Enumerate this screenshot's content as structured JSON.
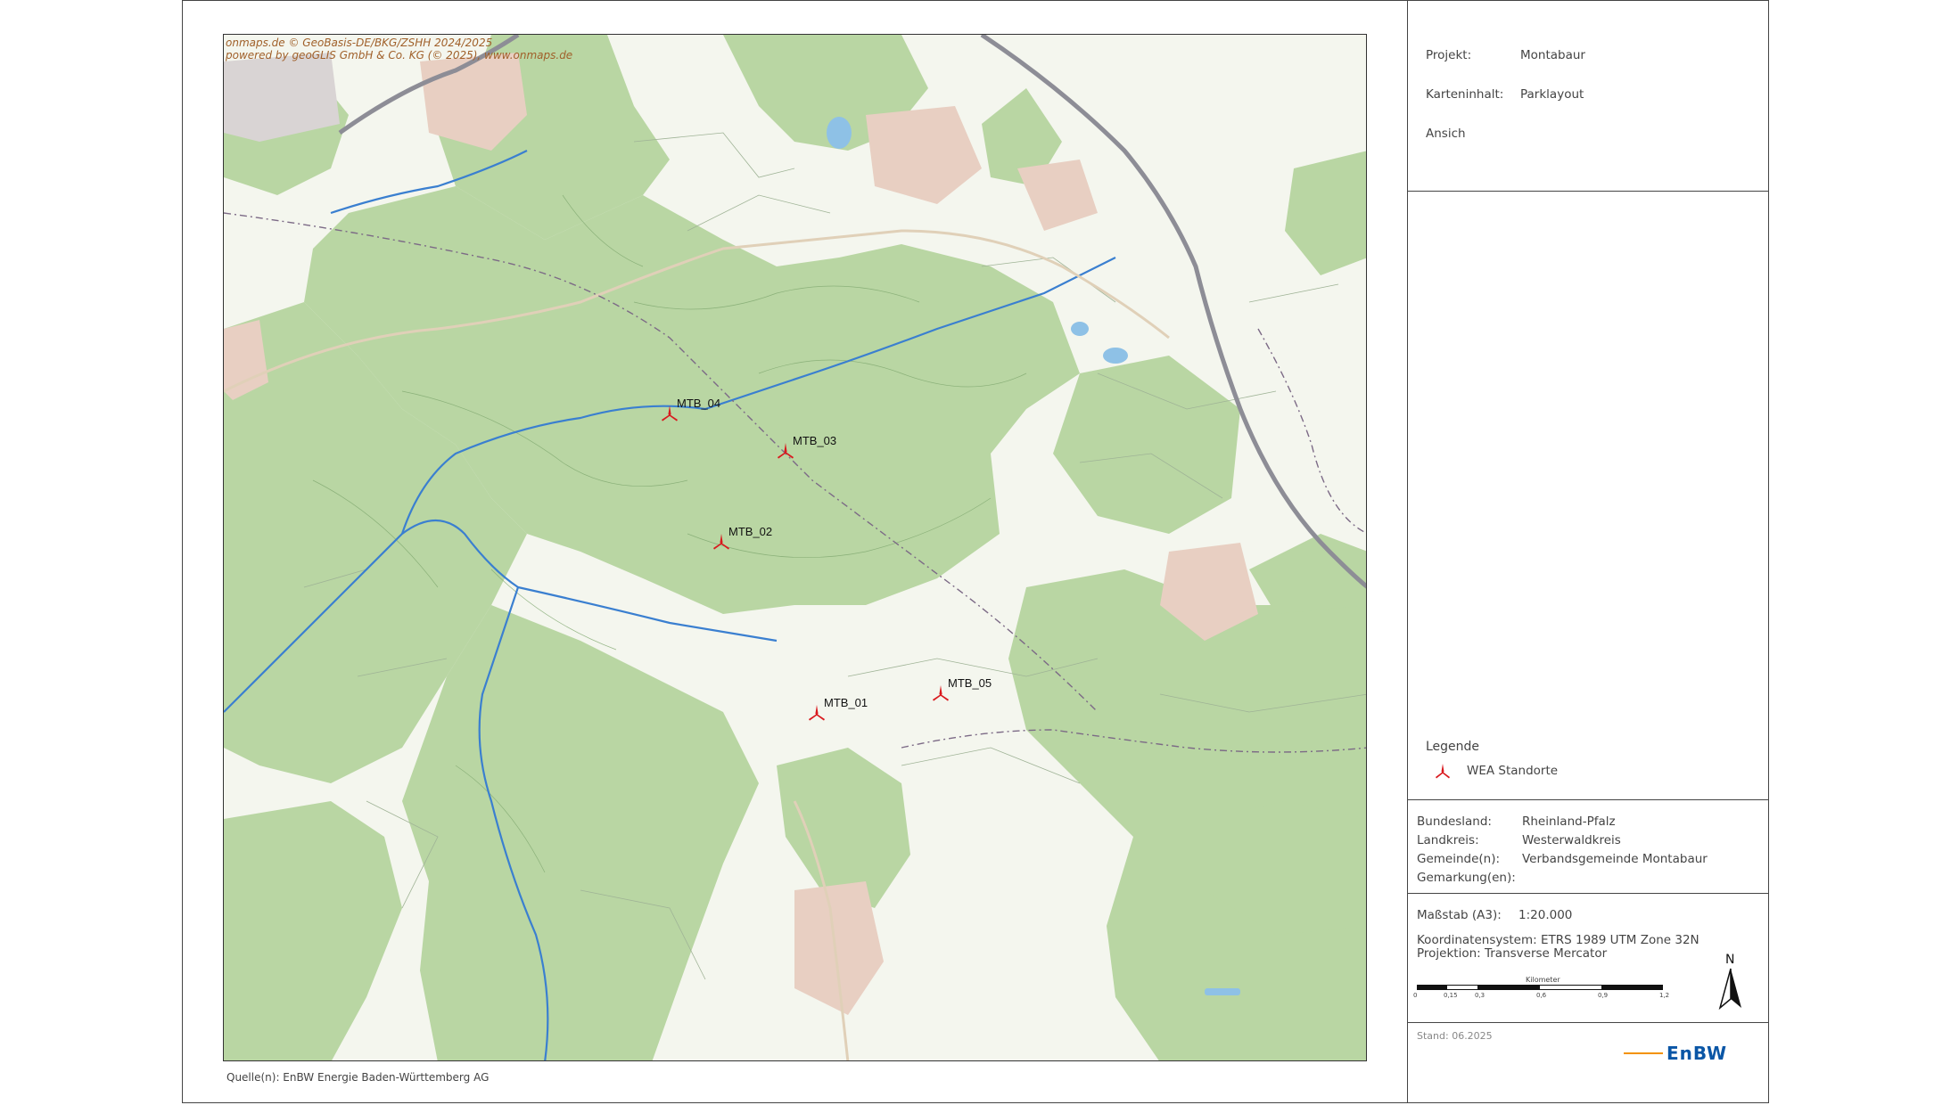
{
  "map": {
    "copyright_line1": "onmaps.de © GeoBasis-DE/BKG/ZSHH 2024/2025",
    "copyright_line2": "powered by geoGLIS GmbH & Co. KG (© 2025), www.onmaps.de",
    "source": "Quelle(n):   EnBW Energie Baden-Württemberg AG",
    "turbines": [
      {
        "id": "MTB_01",
        "label": "MTB_01"
      },
      {
        "id": "MTB_02",
        "label": "MTB_02"
      },
      {
        "id": "MTB_03",
        "label": "MTB_03"
      },
      {
        "id": "MTB_04",
        "label": "MTB_04"
      },
      {
        "id": "MTB_05",
        "label": "MTB_05"
      }
    ],
    "colors": {
      "forest": "#b9d6a3",
      "open": "#f4f6ee",
      "water": "#3a7fd0",
      "road": "#8d8d96",
      "turbine": "#d9191e"
    }
  },
  "info": {
    "projekt_label": "Projekt:",
    "projekt_value": "Montabaur",
    "karteninhalt_label": "Karteninhalt:",
    "karteninhalt_value": "Parklayout",
    "ansicht_label": "Ansich"
  },
  "legend": {
    "title": "Legende",
    "item": "WEA Standorte",
    "icon": "wind-turbine-icon"
  },
  "admin": {
    "bundesland_label": "Bundesland:",
    "bundesland_value": "Rheinland-Pfalz",
    "landkreis_label": "Landkreis:",
    "landkreis_value": "Westerwaldkreis",
    "gemeinde_label": "Gemeinde(n):",
    "gemeinde_value": "Verbandsgemeinde Montabaur",
    "gemarkung_label": "Gemarkung(en):"
  },
  "scale": {
    "massstab_label": "Maßstab (A3):",
    "massstab_value": "1:20.000",
    "koordinaten": "Koordinatensystem: ETRS 1989 UTM Zone 32N",
    "projektion": "Projektion: Transverse Mercator",
    "bar_unit": "Kilometer",
    "ticks": [
      "0",
      "0,15",
      "0,3",
      "0,6",
      "0,9",
      "1,2"
    ],
    "north": "N"
  },
  "footer": {
    "stand": "Stand: 06.2025",
    "logo": "EnBW",
    "logo_color": "#0a56a6",
    "logo_accent": "#f39200"
  }
}
